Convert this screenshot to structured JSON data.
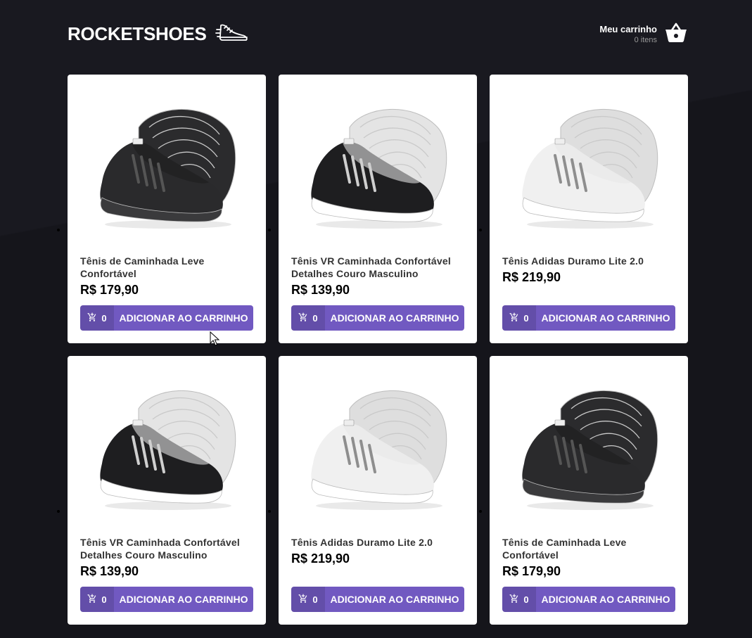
{
  "header": {
    "logo_text": "ROCKETSHOES",
    "logo_icon": "sneaker-icon",
    "cart_title": "Meu carrinho",
    "cart_count": "0 itens",
    "cart_icon": "basket-icon"
  },
  "colors": {
    "background": "#191920",
    "accent": "#7159c1"
  },
  "products": [
    {
      "title": "Tênis de Caminhada Leve Confortável",
      "price": "R$ 179,90",
      "amount": "0",
      "button": "ADICIONAR AO CARRINHO",
      "variant": "black"
    },
    {
      "title": "Tênis VR Caminhada Confortável Detalhes Couro Masculino",
      "price": "R$ 139,90",
      "amount": "0",
      "button": "ADICIONAR AO CARRINHO",
      "variant": "black-white"
    },
    {
      "title": "Tênis Adidas Duramo Lite 2.0",
      "price": "R$ 219,90",
      "amount": "0",
      "button": "ADICIONAR AO CARRINHO",
      "variant": "white-grey"
    },
    {
      "title": "Tênis VR Caminhada Confortável Detalhes Couro Masculino",
      "price": "R$ 139,90",
      "amount": "0",
      "button": "ADICIONAR AO CARRINHO",
      "variant": "black-white"
    },
    {
      "title": "Tênis Adidas Duramo Lite 2.0",
      "price": "R$ 219,90",
      "amount": "0",
      "button": "ADICIONAR AO CARRINHO",
      "variant": "white-grey"
    },
    {
      "title": "Tênis de Caminhada Leve Confortável",
      "price": "R$ 179,90",
      "amount": "0",
      "button": "ADICIONAR AO CARRINHO",
      "variant": "black"
    }
  ]
}
